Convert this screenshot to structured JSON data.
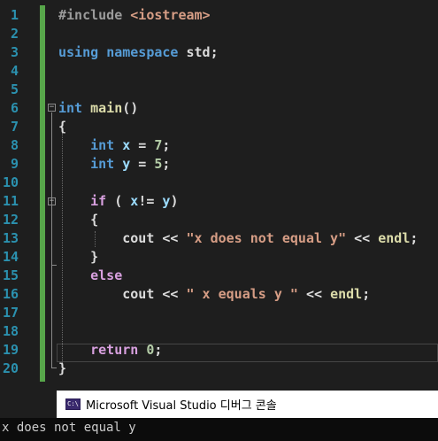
{
  "editor": {
    "line_numbers": [
      "1",
      "2",
      "3",
      "4",
      "5",
      "6",
      "7",
      "8",
      "9",
      "10",
      "11",
      "12",
      "13",
      "14",
      "15",
      "16",
      "17",
      "18",
      "19",
      "20"
    ],
    "lines": [
      [
        {
          "t": "#include ",
          "c": "pp"
        },
        {
          "t": "<iostream>",
          "c": "str"
        }
      ],
      [],
      [
        {
          "t": "using",
          "c": "kw"
        },
        {
          "t": " ",
          "c": ""
        },
        {
          "t": "namespace",
          "c": "kw"
        },
        {
          "t": " std;",
          "c": ""
        }
      ],
      [],
      [],
      [
        {
          "t": "int",
          "c": "kw"
        },
        {
          "t": " ",
          "c": ""
        },
        {
          "t": "main",
          "c": "fn"
        },
        {
          "t": "()",
          "c": ""
        }
      ],
      [
        {
          "t": "{",
          "c": ""
        }
      ],
      [
        {
          "t": "    ",
          "c": ""
        },
        {
          "t": "int",
          "c": "kw"
        },
        {
          "t": " ",
          "c": ""
        },
        {
          "t": "x",
          "c": "var"
        },
        {
          "t": " = ",
          "c": ""
        },
        {
          "t": "7",
          "c": "num"
        },
        {
          "t": ";",
          "c": ""
        }
      ],
      [
        {
          "t": "    ",
          "c": ""
        },
        {
          "t": "int",
          "c": "kw"
        },
        {
          "t": " ",
          "c": ""
        },
        {
          "t": "y",
          "c": "var"
        },
        {
          "t": " = ",
          "c": ""
        },
        {
          "t": "5",
          "c": "num"
        },
        {
          "t": ";",
          "c": ""
        }
      ],
      [],
      [
        {
          "t": "    ",
          "c": ""
        },
        {
          "t": "if",
          "c": "ctl"
        },
        {
          "t": " ( ",
          "c": ""
        },
        {
          "t": "x",
          "c": "var"
        },
        {
          "t": "!= ",
          "c": ""
        },
        {
          "t": "y",
          "c": "var"
        },
        {
          "t": ")",
          "c": ""
        }
      ],
      [
        {
          "t": "    {",
          "c": ""
        }
      ],
      [
        {
          "t": "        cout << ",
          "c": ""
        },
        {
          "t": "\"x does not equal y\"",
          "c": "str"
        },
        {
          "t": " << ",
          "c": ""
        },
        {
          "t": "endl",
          "c": "fn"
        },
        {
          "t": ";",
          "c": ""
        }
      ],
      [
        {
          "t": "    }",
          "c": ""
        }
      ],
      [
        {
          "t": "    ",
          "c": ""
        },
        {
          "t": "else",
          "c": "ctl"
        }
      ],
      [
        {
          "t": "        cout << ",
          "c": ""
        },
        {
          "t": "\" x equals y \"",
          "c": "str"
        },
        {
          "t": " << ",
          "c": ""
        },
        {
          "t": "endl",
          "c": "fn"
        },
        {
          "t": ";",
          "c": ""
        }
      ],
      [],
      [],
      [
        {
          "t": "    ",
          "c": ""
        },
        {
          "t": "return",
          "c": "ctl"
        },
        {
          "t": " ",
          "c": ""
        },
        {
          "t": "0",
          "c": "num"
        },
        {
          "t": ";",
          "c": ""
        }
      ],
      [
        {
          "t": "}",
          "c": ""
        }
      ]
    ],
    "fold_markers": [
      "−",
      "−"
    ]
  },
  "console": {
    "icon_label": "C:\\",
    "title": "Microsoft Visual Studio 디버그 콘솔",
    "output": "x does not equal y"
  },
  "colors": {
    "background": "#1e1e1e",
    "line_number": "#2b91af",
    "keyword": "#569cd6",
    "control": "#d8a0df",
    "string": "#d69d85",
    "number": "#b5cea8",
    "change_bar": "#57a64a"
  }
}
